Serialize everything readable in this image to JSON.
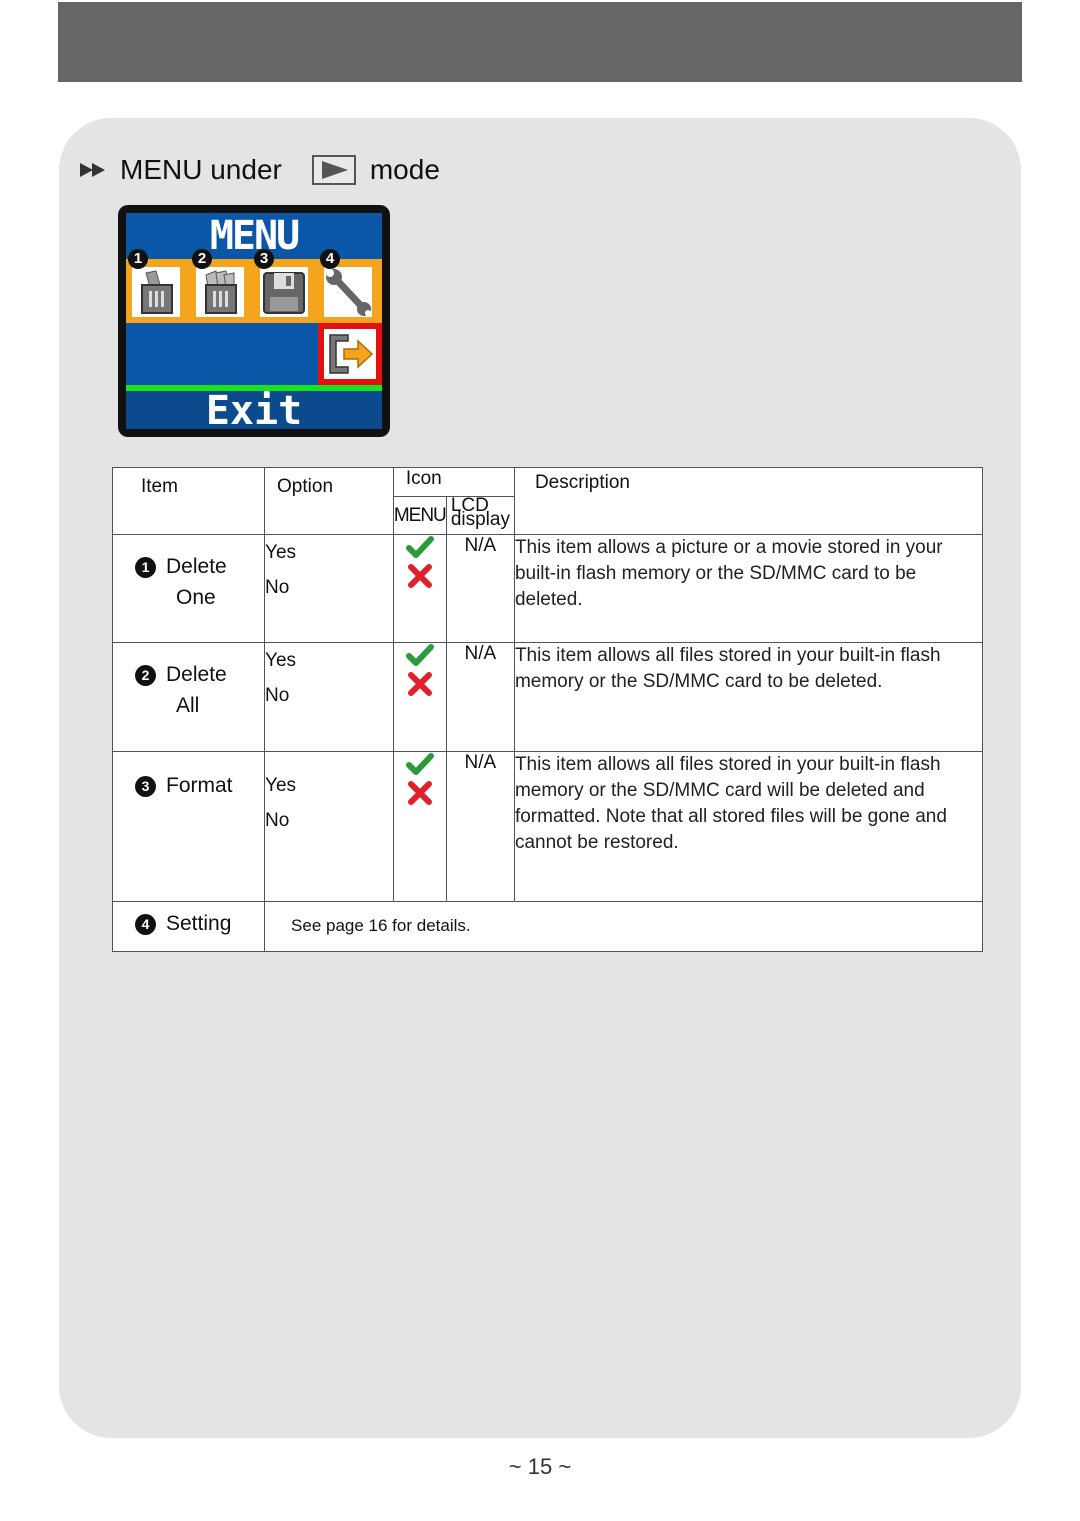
{
  "page": {
    "title_prefix": "MENU under",
    "title_suffix": "mode",
    "mode_icon": "play-icon",
    "page_number": "~ 15 ~"
  },
  "lcd": {
    "title": "MENU",
    "bottom_label": "Exit",
    "items": [
      {
        "num": "1",
        "icon": "delete-one-trash-icon"
      },
      {
        "num": "2",
        "icon": "delete-all-trash-icon"
      },
      {
        "num": "3",
        "icon": "format-floppy-icon"
      },
      {
        "num": "4",
        "icon": "setting-wrench-icon"
      }
    ],
    "selected_icon": "exit-icon",
    "colors": {
      "screen": "#0a57a8",
      "strip": "#f4a51d",
      "selection": "#e51010",
      "bar": "#16e41d"
    }
  },
  "table": {
    "headers": {
      "item": "Item",
      "option": "Option",
      "icon": "Icon",
      "icon_menu": "MENU",
      "icon_lcd": "LCD display",
      "description": "Description"
    },
    "rows": [
      {
        "num": "1",
        "item_line1": "Delete",
        "item_line2": "One",
        "options": [
          "Yes",
          "No"
        ],
        "lcd": "N/A",
        "description": "This item allows a picture or a movie stored in your built-in flash memory or the SD/MMC card to be deleted."
      },
      {
        "num": "2",
        "item_line1": "Delete",
        "item_line2": "All",
        "options": [
          "Yes",
          "No"
        ],
        "lcd": "N/A",
        "description": "This item allows all files stored in your built-in flash memory or the SD/MMC card to be deleted."
      },
      {
        "num": "3",
        "item_line1": "Format",
        "item_line2": "",
        "options": [
          "Yes",
          "No"
        ],
        "lcd": "N/A",
        "description": "This item allows all files stored in your built-in flash memory or the SD/MMC card will be deleted and formatted. Note that all stored files will be gone and cannot be restored."
      },
      {
        "num": "4",
        "item_line1": "Setting",
        "details": "See page 16 for details."
      }
    ]
  }
}
